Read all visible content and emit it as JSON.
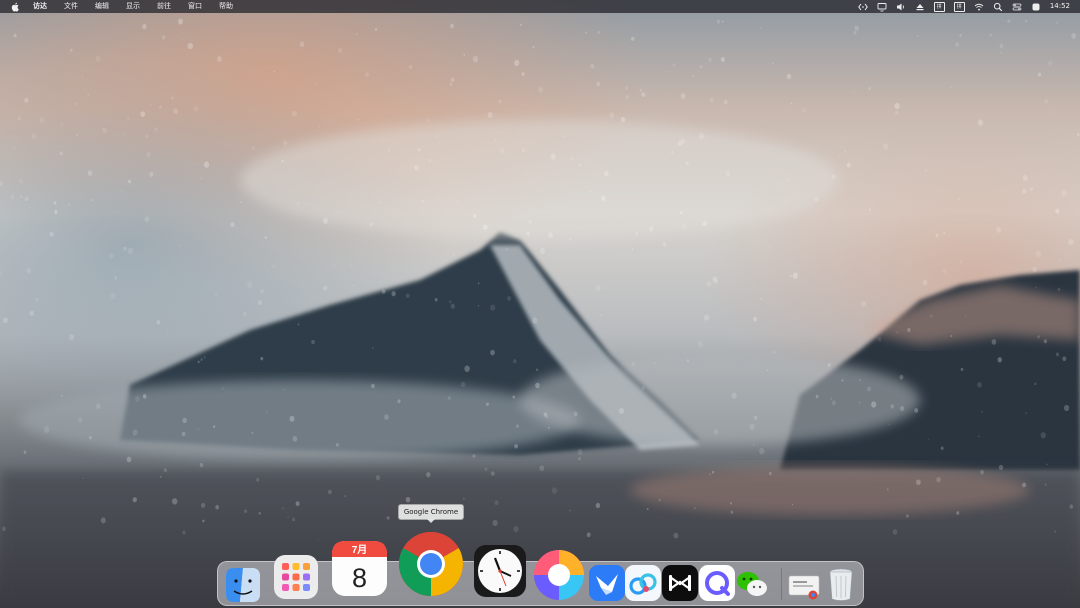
{
  "menubar": {
    "items": [
      "访达",
      "文件",
      "编辑",
      "显示",
      "前往",
      "窗口",
      "帮助"
    ],
    "ime_label_1": "拼",
    "ime_label_2": "拼",
    "time": "14:52"
  },
  "dock": {
    "tooltip": "Google Chrome",
    "calendar_month": "7月",
    "calendar_day": "8",
    "apps": [
      "finder",
      "launchpad",
      "calendar",
      "google-chrome",
      "clock",
      "spin-app",
      "feishu",
      "baidu-netdisk",
      "capcut",
      "quark",
      "wechat",
      "downloads",
      "trash"
    ]
  },
  "colors": {
    "menubar_bg": "#28282e",
    "chrome_red": "#db4437",
    "chrome_yellow": "#f4b400",
    "chrome_green": "#0f9d58",
    "chrome_blue": "#4285f4"
  }
}
